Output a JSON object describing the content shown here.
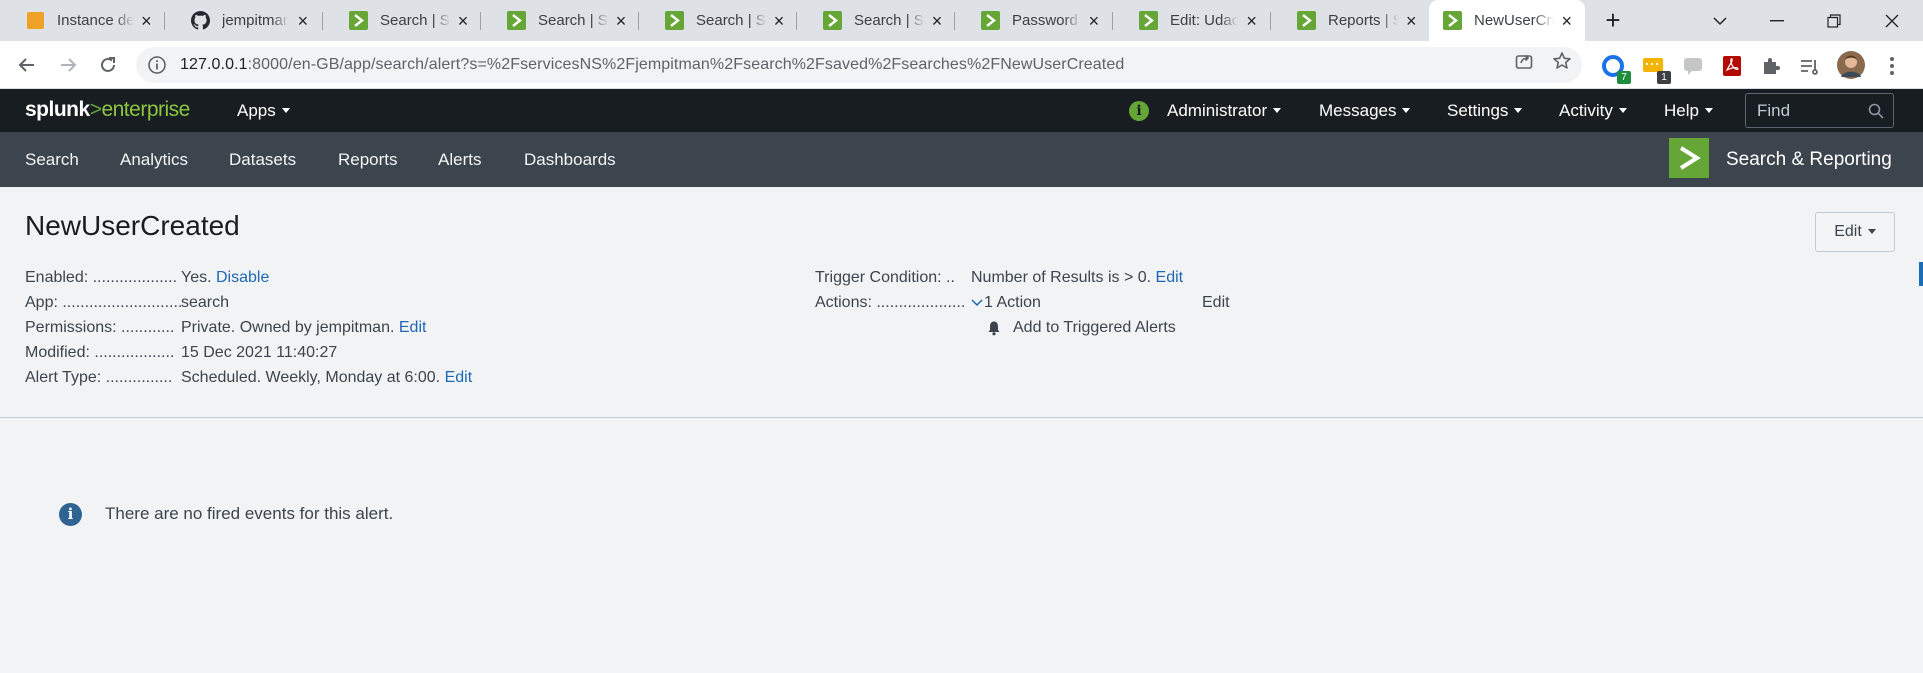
{
  "browser": {
    "tabs": [
      {
        "title": "Instance details",
        "favicon": "aws-icon"
      },
      {
        "title": "jempitman/",
        "favicon": "github-icon"
      },
      {
        "title": "Search | Splunk",
        "favicon": "splunk-icon"
      },
      {
        "title": "Search | Splunk",
        "favicon": "splunk-icon"
      },
      {
        "title": "Search | Splunk",
        "favicon": "splunk-icon"
      },
      {
        "title": "Search | Splunk",
        "favicon": "splunk-icon"
      },
      {
        "title": "Password en",
        "favicon": "splunk-icon"
      },
      {
        "title": "Edit: Udacity",
        "favicon": "splunk-icon"
      },
      {
        "title": "Reports | Splunk",
        "favicon": "splunk-icon"
      },
      {
        "title": "NewUserCreated",
        "favicon": "splunk-icon",
        "active": true
      }
    ],
    "new_tab_label": "+",
    "url_host": "127.0.0.1",
    "url_rest": ":8000/en-GB/app/search/alert?s=%2FservicesNS%2Fjempitman%2Fsearch%2Fsaved%2Fsearches%2FNewUserCreated",
    "extensions": [
      {
        "name": "extension-c-icon",
        "badge": "7",
        "badge_color": "#1e8e3e"
      },
      {
        "name": "extension-note-icon",
        "badge": "1",
        "badge_color": "#3c4043"
      }
    ]
  },
  "splunk": {
    "logo_word": "splunk",
    "logo_gt": ">",
    "logo_product": "enterprise",
    "top_menu": {
      "apps": "Apps",
      "user": "Administrator",
      "messages": "Messages",
      "settings": "Settings",
      "activity": "Activity",
      "help": "Help"
    },
    "find_placeholder": "Find",
    "app_bar": {
      "items": [
        "Search",
        "Analytics",
        "Datasets",
        "Reports",
        "Alerts",
        "Dashboards"
      ],
      "app_name": "Search & Reporting"
    },
    "colors": {
      "brand_green": "#65a637",
      "link_blue": "#1e67b5",
      "header_dark": "#171d21",
      "appbar": "#3c444d"
    }
  },
  "alert": {
    "title": "NewUserCreated",
    "edit_button": "Edit",
    "details_left": [
      {
        "label": "Enabled: ...................",
        "value": "Yes.",
        "link": "Disable"
      },
      {
        "label": "App: ...........................",
        "value": "search",
        "link": ""
      },
      {
        "label": "Permissions: ............",
        "value": "Private. Owned by jempitman.",
        "link": "Edit"
      },
      {
        "label": "Modified: ..................",
        "value": "15 Dec 2021 11:40:27",
        "link": ""
      },
      {
        "label": "Alert Type: ...............",
        "value": "Scheduled. Weekly, Monday at 6:00.",
        "link": "Edit"
      }
    ],
    "trigger_condition": {
      "label": "Trigger Condition: ..",
      "value": "Number of Results is > 0.",
      "link": "Edit"
    },
    "actions": {
      "label": "Actions: ....................",
      "value": "1 Action",
      "link": "Edit",
      "action_item": "Add to Triggered Alerts"
    },
    "no_events_message": "There are no fired events for this alert."
  }
}
